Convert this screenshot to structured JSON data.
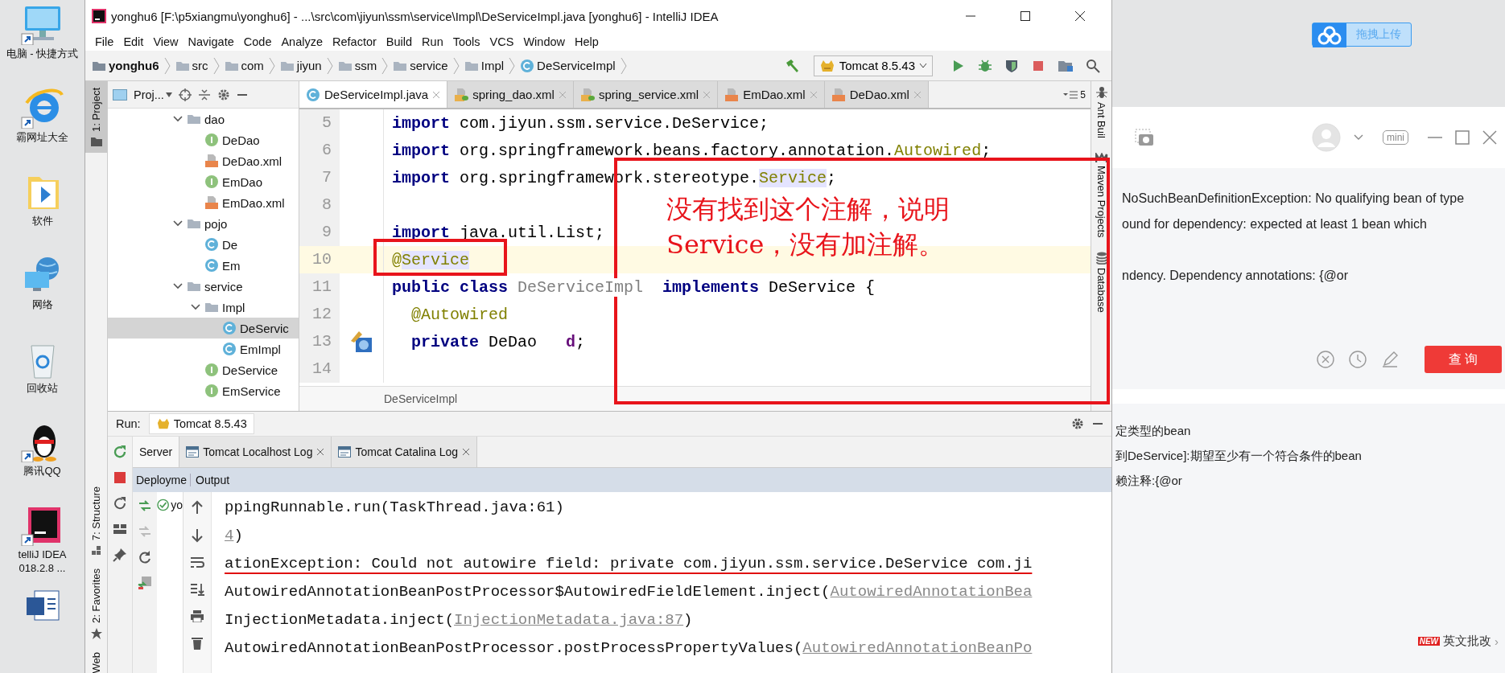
{
  "desktop": {
    "icons": [
      {
        "kind": "computer",
        "label": "电脑 - 快捷方式"
      },
      {
        "kind": "browser",
        "label": "霸网址大全"
      },
      {
        "kind": "folder",
        "label": "软件"
      },
      {
        "kind": "network",
        "label": "网络"
      },
      {
        "kind": "recycle",
        "label": "回收站"
      },
      {
        "kind": "qq",
        "label": "腾讯QQ"
      },
      {
        "kind": "idea",
        "label": "telliJ IDEA 018.2.8 ..."
      },
      {
        "kind": "word"
      }
    ]
  },
  "ide": {
    "title": "yonghu6 [F:\\p5xiangmu\\yonghu6] - ...\\src\\com\\jiyun\\ssm\\service\\Impl\\DeServiceImpl.java [yonghu6] - IntelliJ IDEA",
    "menu": [
      "File",
      "Edit",
      "View",
      "Navigate",
      "Code",
      "Analyze",
      "Refactor",
      "Build",
      "Run",
      "Tools",
      "VCS",
      "Window",
      "Help"
    ],
    "breadcrumbs": [
      {
        "kind": "module",
        "label": "yonghu6"
      },
      {
        "kind": "folder",
        "label": "src"
      },
      {
        "kind": "folder",
        "label": "com"
      },
      {
        "kind": "folder",
        "label": "jiyun"
      },
      {
        "kind": "folder",
        "label": "ssm"
      },
      {
        "kind": "folder",
        "label": "service"
      },
      {
        "kind": "folder",
        "label": "Impl"
      },
      {
        "kind": "class",
        "label": "DeServiceImpl"
      }
    ],
    "run_config": "Tomcat 8.5.43",
    "left_tools_top": [
      {
        "label": "1: Project",
        "selected": true
      }
    ],
    "left_tools_bottom": [
      {
        "kind": "structure",
        "label": "7: Structure",
        "selected": false
      },
      {
        "kind": "favorites",
        "label": "2: Favorites",
        "selected": false
      },
      {
        "kind": "web",
        "label": "Web",
        "selected": false
      }
    ],
    "project_panel": {
      "title": "Proj...",
      "tree": [
        {
          "kind": "folder",
          "label": "dao",
          "expanded": true,
          "selected": false,
          "children": [
            {
              "kind": "interface",
              "label": "DeDao",
              "selected": false
            },
            {
              "kind": "xml",
              "label": "DeDao.xml",
              "selected": false
            },
            {
              "kind": "interface",
              "label": "EmDao",
              "selected": false
            },
            {
              "kind": "xml",
              "label": "EmDao.xml",
              "selected": false
            }
          ]
        },
        {
          "kind": "folder",
          "label": "pojo",
          "expanded": true,
          "selected": false,
          "children": [
            {
              "kind": "class",
              "label": "De",
              "selected": false
            },
            {
              "kind": "class",
              "label": "Em",
              "selected": false
            }
          ]
        },
        {
          "kind": "folder",
          "label": "service",
          "expanded": true,
          "selected": false,
          "children": [
            {
              "kind": "folder",
              "label": "Impl",
              "expanded": true,
              "selected": false,
              "children": [
                {
                  "kind": "class",
                  "label": "DeServic",
                  "selected": true
                },
                {
                  "kind": "class",
                  "label": "EmImpl",
                  "selected": false
                }
              ]
            },
            {
              "kind": "interface",
              "label": "DeService",
              "selected": false
            },
            {
              "kind": "interface",
              "label": "EmService",
              "selected": false
            }
          ]
        }
      ]
    },
    "tabs": [
      {
        "kind": "class",
        "label": "DeServiceImpl.java",
        "selected": true
      },
      {
        "kind": "spring_xml",
        "label": "spring_dao.xml",
        "selected": false
      },
      {
        "kind": "spring_xml",
        "label": "spring_service.xml",
        "selected": false
      },
      {
        "kind": "xml",
        "label": "EmDao.xml",
        "selected": false
      },
      {
        "kind": "xml",
        "label": "DeDao.xml",
        "selected": false
      }
    ],
    "tab_overflow": "5",
    "code": [
      {
        "number": "5",
        "current": false,
        "tokens": [
          {
            "kind": "keyword",
            "text": "import"
          },
          {
            "kind": "plain",
            "text": " com.jiyun.ssm.service.DeService;"
          }
        ]
      },
      {
        "number": "6",
        "current": false,
        "tokens": [
          {
            "kind": "keyword",
            "text": "import"
          },
          {
            "kind": "plain",
            "text": " org.springframework.beans.factory.annotation."
          },
          {
            "kind": "annotation",
            "text": "Autowired"
          },
          {
            "kind": "plain",
            "text": ";"
          }
        ]
      },
      {
        "number": "7",
        "current": false,
        "tokens": [
          {
            "kind": "keyword",
            "text": "import"
          },
          {
            "kind": "plain",
            "text": " org.springframework.stereotype."
          },
          {
            "kind": "annotation_marked",
            "text": "Service"
          },
          {
            "kind": "plain",
            "text": ";"
          }
        ]
      },
      {
        "number": "8",
        "current": false
      },
      {
        "number": "9",
        "current": false,
        "tokens": [
          {
            "kind": "keyword",
            "text": "import"
          },
          {
            "kind": "plain",
            "text": " java.util.List;"
          }
        ]
      },
      {
        "number": "10",
        "current": true,
        "tokens": [
          {
            "kind": "annotation",
            "text": "@"
          },
          {
            "kind": "annotation_marked",
            "text": "Service"
          }
        ]
      },
      {
        "number": "11",
        "current": false,
        "tokens": [
          {
            "kind": "keyword",
            "text": "public"
          },
          {
            "kind": "keyword",
            "text": " class"
          },
          {
            "kind": "unused",
            "text": " DeServiceImpl  "
          },
          {
            "kind": "keyword",
            "text": "implements"
          },
          {
            "kind": "plain",
            "text": " DeService {"
          }
        ]
      },
      {
        "number": "12",
        "current": false,
        "tokens": [
          {
            "kind": "annotation",
            "text": "  @Autowired"
          }
        ]
      },
      {
        "number": "13",
        "current": false,
        "injection_marker": true,
        "tokens": [
          {
            "kind": "keyword",
            "text": "  private"
          },
          {
            "kind": "plain",
            "text": " DeDao   "
          },
          {
            "kind": "field",
            "text": "d"
          },
          {
            "kind": "plain",
            "text": ";"
          }
        ]
      },
      {
        "number": "14",
        "current": false
      }
    ],
    "editor_breadcrumb": "DeServiceImpl",
    "right_tools": [
      {
        "kind": "ant",
        "label": "Ant Buil"
      },
      {
        "kind": "maven",
        "label": "Maven Projects"
      },
      {
        "kind": "database",
        "label": "Database"
      }
    ],
    "run": {
      "label": "Run:",
      "config": "Tomcat 8.5.43",
      "tabs": [
        {
          "kind": "server",
          "label": "Server",
          "selected": true
        },
        {
          "kind": "log",
          "label": "Tomcat Localhost Log",
          "selected": false
        },
        {
          "kind": "log",
          "label": "Tomcat Catalina Log",
          "selected": false
        }
      ],
      "deployment_header": "Deployme",
      "output_header": "Output",
      "deployment_item": "yo",
      "output": [
        {
          "underlined": false,
          "segments": [
            {
              "kind": "plain",
              "text": "ppingRunnable.run(TaskThread.java:61)"
            }
          ]
        },
        {
          "underlined": false,
          "segments": [
            {
              "kind": "link",
              "text": "4"
            },
            {
              "kind": "plain",
              "text": ")"
            }
          ]
        },
        {
          "underlined": true,
          "segments": [
            {
              "kind": "plain",
              "text": "ationException: Could not autowire field: private com.jiyun.ssm.service.DeService com.ji"
            }
          ]
        },
        {
          "underlined": false,
          "segments": [
            {
              "kind": "plain",
              "text": "AutowiredAnnotationBeanPostProcessor$AutowiredFieldElement.inject("
            },
            {
              "kind": "link",
              "text": "AutowiredAnnotationBea"
            }
          ]
        },
        {
          "underlined": false,
          "segments": [
            {
              "kind": "plain",
              "text": "InjectionMetadata.inject("
            },
            {
              "kind": "link",
              "text": "InjectionMetadata.java:87"
            },
            {
              "kind": "plain",
              "text": ")"
            }
          ]
        },
        {
          "underlined": false,
          "segments": [
            {
              "kind": "plain",
              "text": "AutowiredAnnotationBeanPostProcessor.postProcessPropertyValues("
            },
            {
              "kind": "link",
              "text": "AutowiredAnnotationBeanPo"
            }
          ]
        }
      ]
    }
  },
  "annotation": {
    "lines": [
      "没有找到这个注解，说明",
      "Service，没有加注解。"
    ]
  },
  "translator": {
    "upload_button": "拖拽上传",
    "mini": "mini",
    "input_lines": [
      "NoSuchBeanDefinitionException: No qualifying bean of type",
      "ound for dependency: expected at least 1 bean which",
      "ndency.  Dependency annotations: {@or"
    ],
    "query_button": "查 询",
    "results": [
      "定类型的bean",
      "到DeService]:期望至少有一个符合条件的bean",
      "赖注释:{@or"
    ],
    "new_badge": "NEW",
    "feature_link": "英文批改",
    "chevron": "›"
  }
}
